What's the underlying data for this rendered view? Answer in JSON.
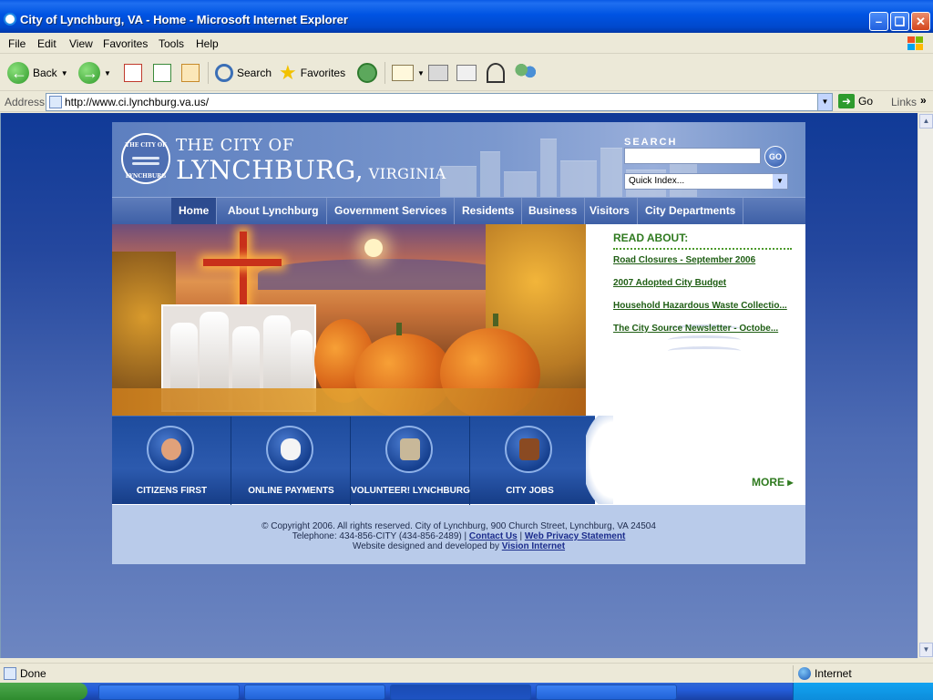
{
  "window": {
    "title": "City of Lynchburg, VA - Home - Microsoft Internet Explorer",
    "minimize": "–",
    "maximize": "❏",
    "close": "✕"
  },
  "menu": [
    "File",
    "Edit",
    "View",
    "Favorites",
    "Tools",
    "Help"
  ],
  "toolbar": {
    "back": "Back",
    "search": "Search",
    "favorites": "Favorites"
  },
  "address": {
    "label": "Address",
    "url": "http://www.ci.lynchburg.va.us/",
    "go": "Go",
    "links": "Links",
    "chevron": "»"
  },
  "site": {
    "seal_top": "THE CITY OF",
    "seal_bottom": "LYNCHBURG",
    "brand_top": "THE CITY OF",
    "brand_main": "LYNCHBURG,",
    "brand_state": " VIRGINIA",
    "search_label": "SEARCH",
    "go_label": "GO",
    "quick_index": "Quick Index...",
    "nav": [
      "Home",
      "About Lynchburg",
      "Government Services",
      "Residents",
      "Business",
      "Visitors",
      "City Departments"
    ],
    "read_about": {
      "title": "READ ABOUT:",
      "links": [
        "Road Closures - September 2006",
        "2007 Adopted City Budget",
        "Household Hazardous Waste Collectio...",
        "The City Source Newsletter - Octobe..."
      ],
      "more": "MORE ▸"
    },
    "quicklinks": [
      "CITIZENS FIRST",
      "ONLINE PAYMENTS",
      "VOLUNTEER! LYNCHBURG",
      "CITY JOBS"
    ],
    "footer": {
      "line1": "© Copyright 2006. All rights reserved. City of Lynchburg, 900 Church Street, Lynchburg, VA 24504",
      "phone": "Telephone: 434-856-CITY (434-856-2489) | ",
      "contact": "Contact Us",
      "pipe": " | ",
      "privacy": "Web Privacy Statement",
      "designed": "Website designed and developed by ",
      "vendor": "Vision Internet"
    }
  },
  "status": {
    "text": "Done",
    "zone": "Internet"
  },
  "colors": {
    "nav_bg": "#3E60A6",
    "read_about_green": "#2F7A1F",
    "page_bg": "#24479E"
  }
}
